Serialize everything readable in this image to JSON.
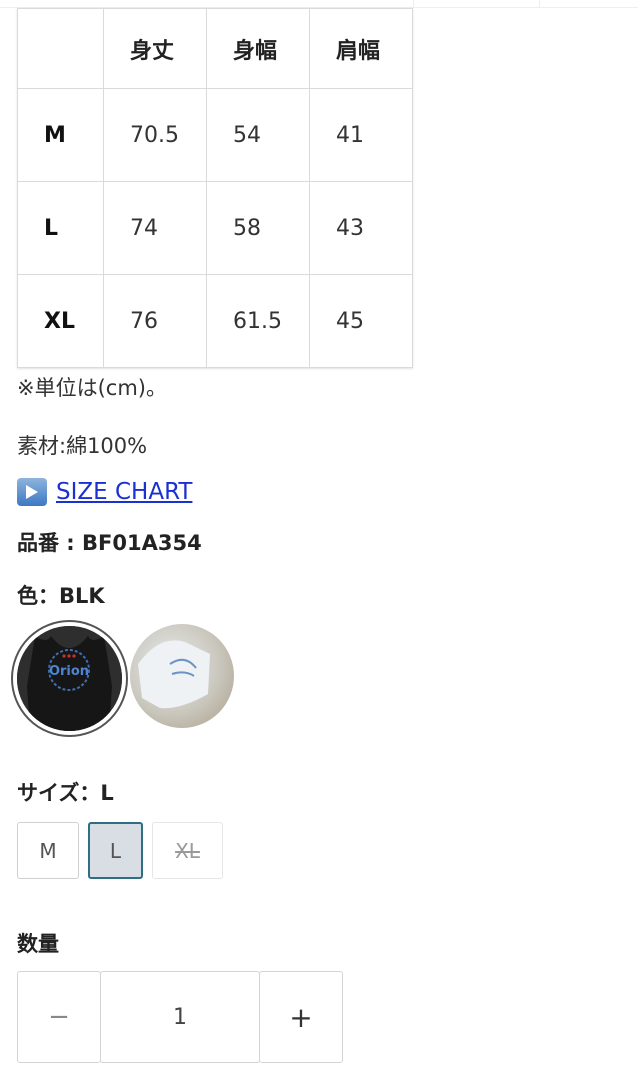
{
  "size_table": {
    "headers": [
      "",
      "身丈",
      "身幅",
      "肩幅"
    ],
    "rows": [
      {
        "size": "M",
        "length": "70.5",
        "width": "54",
        "shoulder": "41"
      },
      {
        "size": "L",
        "length": "74",
        "width": "58",
        "shoulder": "43"
      },
      {
        "size": "XL",
        "length": "76",
        "width": "61.5",
        "shoulder": "45"
      }
    ]
  },
  "unit_note": "※単位は(cm)。",
  "material": "素材:綿100%",
  "size_chart_link": {
    "icon": "play-button-icon",
    "label": "SIZE CHART",
    "color": "#1a2fd4"
  },
  "product_code": "品番 : BF01A354",
  "color_selector": {
    "label": "色：BLK",
    "options": [
      {
        "name": "black-tank-top-swatch",
        "selected": true,
        "logo_text": "Orion"
      },
      {
        "name": "white-tank-top-swatch",
        "selected": false
      }
    ]
  },
  "size_selector": {
    "label": "サイズ：L",
    "options": [
      {
        "label": "M",
        "selected": false,
        "available": true
      },
      {
        "label": "L",
        "selected": true,
        "available": true
      },
      {
        "label": "XL",
        "selected": false,
        "available": false
      }
    ],
    "accent": "#2f6f84"
  },
  "quantity": {
    "label": "数量",
    "minus": "−",
    "value": "1",
    "plus": "+"
  }
}
